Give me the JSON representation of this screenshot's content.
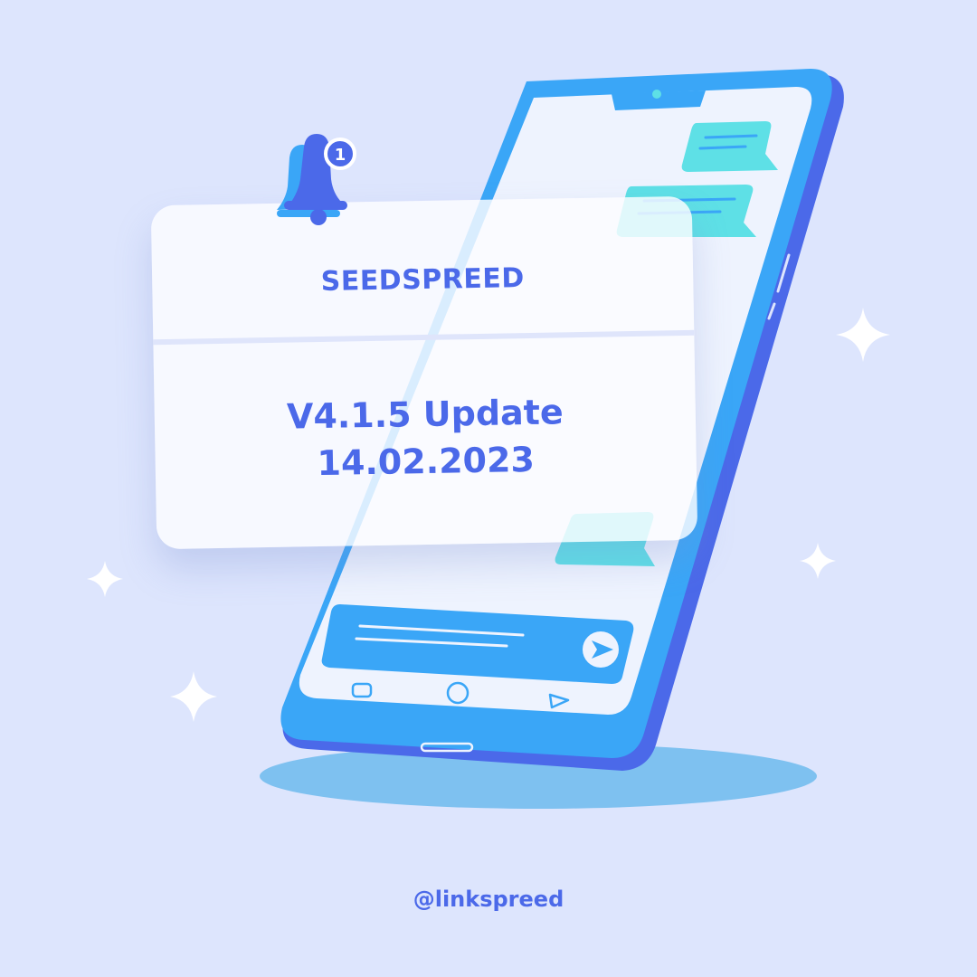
{
  "notification": {
    "app_name": "SEEDSPREED",
    "headline": "V4.1.5 Update",
    "date": "14.02.2023",
    "badge_count": "1"
  },
  "footer": {
    "handle": "@linkspreed"
  },
  "colors": {
    "background": "#dde5fd",
    "phone_frame": "#3aa6f7",
    "phone_shadow": "#4b69e9",
    "bubble": "#5ee0e6",
    "accent_text": "#4b69e9",
    "card": "#fcfdff"
  }
}
